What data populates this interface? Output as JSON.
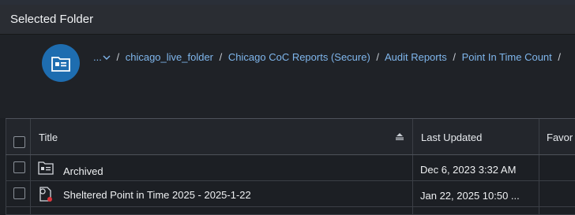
{
  "header": {
    "title": "Selected Folder"
  },
  "breadcrumb": {
    "more": "...",
    "items": [
      {
        "label": "chicago_live_folder"
      },
      {
        "label": "Chicago CoC Reports (Secure)"
      },
      {
        "label": "Audit Reports"
      },
      {
        "label": "Point In Time Count"
      }
    ],
    "separator": "/"
  },
  "table": {
    "columns": {
      "title": "Title",
      "last_updated": "Last Updated",
      "favorite": "Favor"
    },
    "rows": [
      {
        "title": "Archived",
        "type": "folder-icon",
        "last_updated": "Dec 6, 2023 3:32 AM"
      },
      {
        "title": "Sheltered Point in Time 2025 - 2025-1-22",
        "type": "report-icon",
        "last_updated": "Jan 22, 2025 10:50 ..."
      }
    ]
  },
  "colors": {
    "accent": "#1e6db0",
    "link": "#7fb6ec",
    "background": "#1c1f24"
  }
}
